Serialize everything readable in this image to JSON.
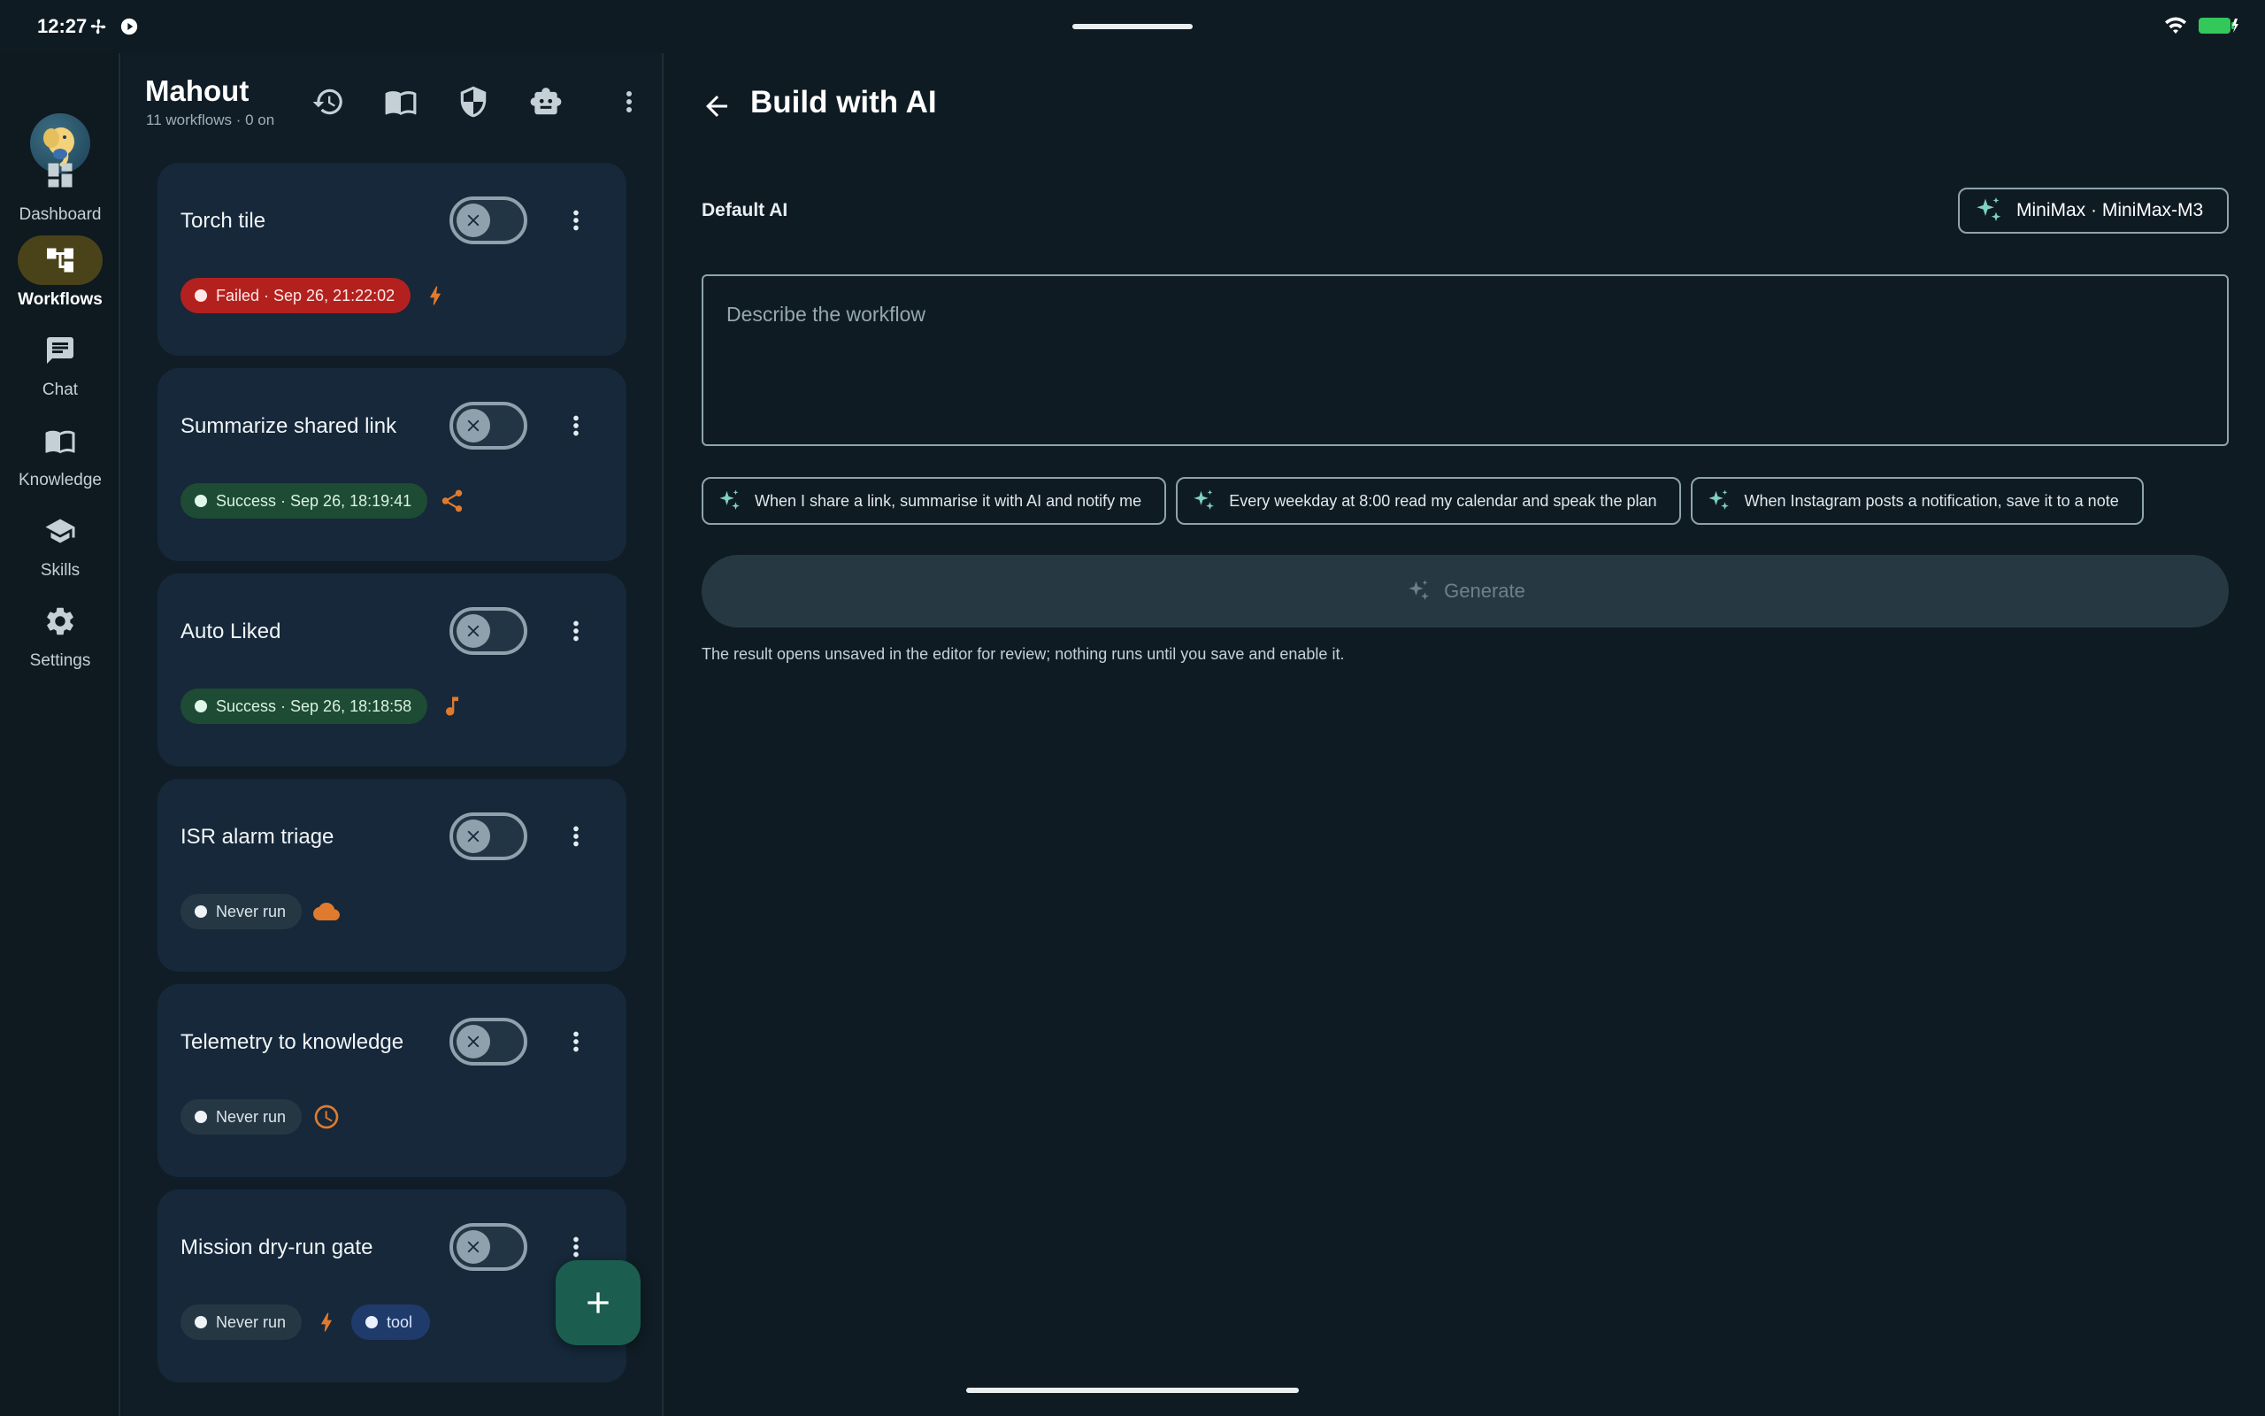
{
  "status_bar": {
    "time": "12:27"
  },
  "rail": {
    "items": [
      {
        "label": "Dashboard",
        "icon": "dashboard-icon",
        "active": false
      },
      {
        "label": "Workflows",
        "icon": "workflows-icon",
        "active": true
      },
      {
        "label": "Chat",
        "icon": "chat-icon",
        "active": false
      },
      {
        "label": "Knowledge",
        "icon": "book-icon",
        "active": false
      },
      {
        "label": "Skills",
        "icon": "school-icon",
        "active": false
      },
      {
        "label": "Settings",
        "icon": "gear-icon",
        "active": false
      }
    ]
  },
  "list": {
    "title": "Mahout",
    "subtitle": "11 workflows · 0 on",
    "workflows": [
      {
        "title": "Torch tile",
        "status": "Failed · Sep 26, 21:22:02",
        "status_kind": "failed",
        "trigger_icon": "bolt-icon",
        "enabled": false
      },
      {
        "title": "Summarize shared link",
        "status": "Success · Sep 26, 18:19:41",
        "status_kind": "success",
        "trigger_icon": "share-icon",
        "enabled": false
      },
      {
        "title": "Auto Liked",
        "status": "Success · Sep 26, 18:18:58",
        "status_kind": "success",
        "trigger_icon": "music-note-icon",
        "enabled": false
      },
      {
        "title": "ISR alarm triage",
        "status": "Never run",
        "status_kind": "never",
        "trigger_icon": "cloud-icon",
        "enabled": false
      },
      {
        "title": "Telemetry to knowledge",
        "status": "Never run",
        "status_kind": "never",
        "trigger_icon": "clock-icon",
        "enabled": false
      },
      {
        "title": "Mission dry-run gate",
        "status": "Never run",
        "status_kind": "never",
        "trigger_icon": "bolt-icon",
        "tag": "tool",
        "enabled": false
      }
    ]
  },
  "main": {
    "title": "Build with AI",
    "default_ai_label": "Default AI",
    "model": "MiniMax · MiniMax-M3",
    "describe_placeholder": "Describe the workflow",
    "suggestions": [
      "When I share a link, summarise it with AI and notify me",
      "Every weekday at 8:00 read my calendar and speak the plan",
      "When Instagram posts a notification, save it to a note"
    ],
    "generate_label": "Generate",
    "footnote": "The result opens unsaved in the editor for review; nothing runs until you save and enable it."
  },
  "colors": {
    "background": "#0f1b23",
    "card": "#16283a",
    "accent_orange": "#e07a2e",
    "accent_teal": "#7fd1c4",
    "failed": "#b3211f",
    "success": "#1e4b33"
  }
}
